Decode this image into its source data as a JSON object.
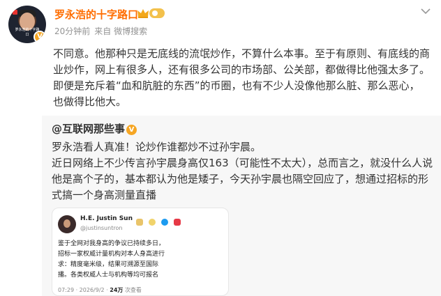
{
  "post": {
    "username": "罗永浩的十字路口",
    "timestamp": "20分钟前",
    "source": "来自 微博搜索",
    "body": "不同意。他那种只是无底线的流氓炒作，不算什么本事。至于有原则、有底线的商业炒作，网上有很多人，还有很多公司的市场部、公关部，都做得比他强太多了。即便是充斥着“血和肮脏的东西”的币圈，也有不少人没像他那么脏、那么恶心，也做得比他大。",
    "avatar_tagline": "罗永浩的十字路口"
  },
  "repost": {
    "author": "@互联网那些事",
    "vip_mark": "V",
    "text_line1": "罗永浩看人真准！论炒作谁都炒不过孙宇晨。",
    "text_body": "近日网络上不少传言孙宇晨身高仅163（可能性不太大），总而言之，就没什么人说他是高个子的，基本都认为他是矮子，今天孙宇晨也隔空回应了，想通过招标的形式搞一个身高测量直播"
  },
  "embedded": {
    "name": "H.E. Justin Sun",
    "handle": "@justinsuntron",
    "lines": [
      "鉴于全网对我身高的争议已持续多日，",
      "招标一家权威计量机构对本人身高进行",
      "求：精度毫米级，结果可溯源至国际",
      "播。各类权威人士与机构等均可报名"
    ],
    "footer_time": "07:29 · 2026/9/2 ·",
    "footer_views": "24万",
    "footer_suffix": "次查看"
  },
  "colors": {
    "username": "#ff6d00",
    "meta": "#939393",
    "repost_bg": "#f7f7f7",
    "vip": "#f6a623"
  },
  "icons": [
    "chevron-down-icon",
    "crown-icon",
    "vip-badge-icon"
  ]
}
